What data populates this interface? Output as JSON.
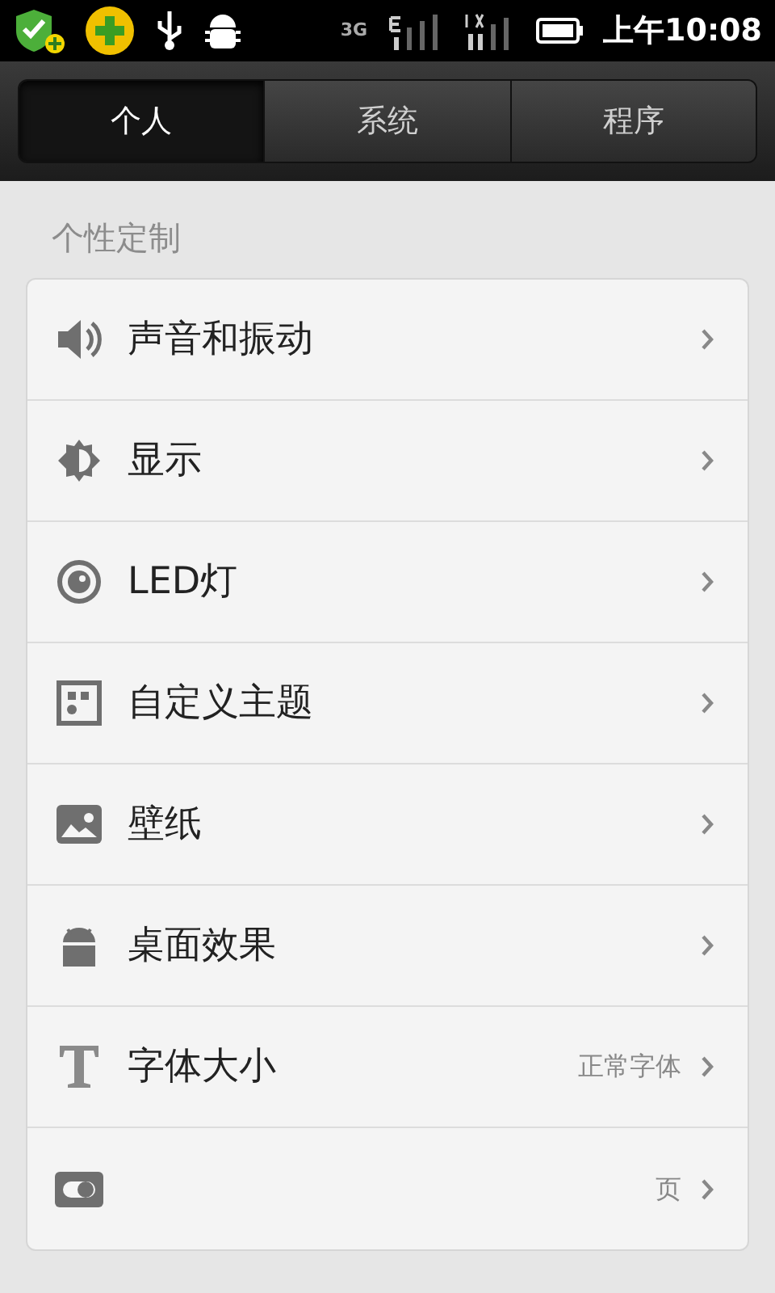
{
  "status_bar": {
    "time": "上午10:08",
    "network": "3G"
  },
  "tabs": [
    {
      "label": "个人",
      "selected": true
    },
    {
      "label": "系统",
      "selected": false
    },
    {
      "label": "程序",
      "selected": false
    }
  ],
  "section": {
    "title": "个性定制"
  },
  "items": [
    {
      "label": "声音和振动"
    },
    {
      "label": "显示"
    },
    {
      "label": "LED灯"
    },
    {
      "label": "自定义主题"
    },
    {
      "label": "壁纸"
    },
    {
      "label": "桌面效果"
    },
    {
      "label": "字体大小",
      "value": "正常字体"
    },
    {
      "value": "页"
    }
  ]
}
